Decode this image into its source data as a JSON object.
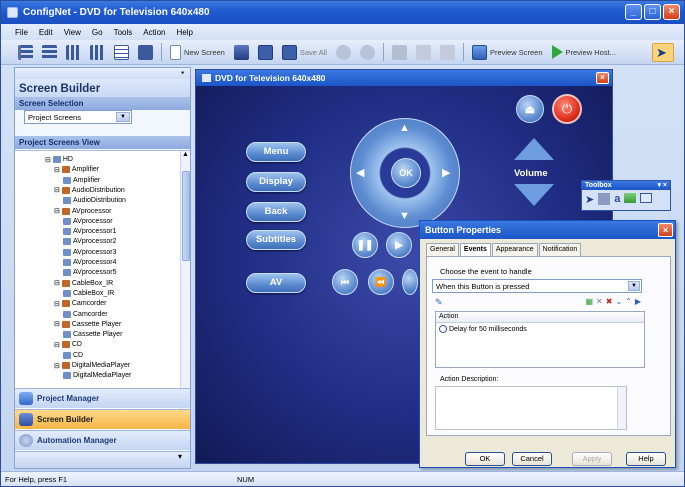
{
  "window": {
    "title": "ConfigNet - DVD for Television 640x480"
  },
  "menu": [
    "File",
    "Edit",
    "View",
    "Go",
    "Tools",
    "Action",
    "Help"
  ],
  "toolbar": {
    "new_screen": "New Screen",
    "save_all": "Save All",
    "preview_screen": "Preview Screen",
    "preview_host": "Preview Host..."
  },
  "left": {
    "title": "Screen Builder",
    "screen_selection_label": "Screen Selection",
    "screen_selection_value": "Project Screens",
    "project_screens_label": "Project Screens View",
    "tree": [
      {
        "label": "HD",
        "level": 0
      },
      {
        "label": "Amplifier",
        "level": 1
      },
      {
        "label": "Amplifier",
        "level": 2
      },
      {
        "label": "AudioDistribution",
        "level": 1
      },
      {
        "label": "AudioDistribution",
        "level": 2
      },
      {
        "label": "AVprocessor",
        "level": 1
      },
      {
        "label": "AVprocessor",
        "level": 2
      },
      {
        "label": "AVprocessor1",
        "level": 2
      },
      {
        "label": "AVprocessor2",
        "level": 2
      },
      {
        "label": "AVprocessor3",
        "level": 2
      },
      {
        "label": "AVprocessor4",
        "level": 2
      },
      {
        "label": "AVprocessor5",
        "level": 2
      },
      {
        "label": "CableBox_IR",
        "level": 1
      },
      {
        "label": "CableBox_IR",
        "level": 2
      },
      {
        "label": "Camcorder",
        "level": 1
      },
      {
        "label": "Camcorder",
        "level": 2
      },
      {
        "label": "Cassette Player",
        "level": 1
      },
      {
        "label": "Cassette Player",
        "level": 2
      },
      {
        "label": "CD",
        "level": 1
      },
      {
        "label": "CD",
        "level": 2
      },
      {
        "label": "DigitalMediaPlayer",
        "level": 1
      },
      {
        "label": "DigitalMediaPlayer",
        "level": 2
      }
    ],
    "nav": {
      "project_manager": "Project Manager",
      "screen_builder": "Screen Builder",
      "automation_manager": "Automation Manager"
    }
  },
  "canvas": {
    "title": "DVD for Television 640x480",
    "buttons": {
      "menu": "Menu",
      "display": "Display",
      "back": "Back",
      "subtitles": "Subtitles",
      "av": "AV",
      "ok": "OK",
      "volume": "Volume"
    }
  },
  "toolbox": {
    "title": "Toolbox"
  },
  "dialog": {
    "title": "Button Properties",
    "tabs": [
      "General",
      "Events",
      "Appearance",
      "Notification"
    ],
    "active_tab": "Events",
    "choose_label": "Choose the event to handle",
    "event_value": "When this Button is pressed",
    "action_header": "Action",
    "action_item": "Delay for 50 milliseconds",
    "action_desc_label": "Action Description:",
    "buttons": {
      "ok": "OK",
      "cancel": "Cancel",
      "apply": "Apply",
      "help": "Help"
    }
  },
  "status": {
    "text": "For Help, press F1",
    "num": "NUM"
  },
  "colors": {
    "titlebar": "#1f5ad0",
    "accent_orange": "#f6b648",
    "remote_bg": "#202d84",
    "power_red": "#e0301e"
  }
}
